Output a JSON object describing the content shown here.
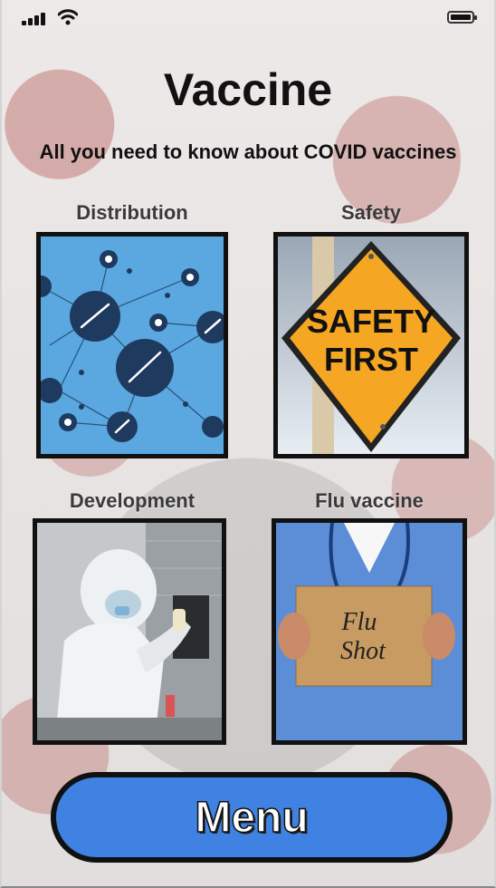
{
  "app": {
    "title": "Vaccine",
    "subtitle": "All you need to know about COVID vaccines"
  },
  "status_bar": {
    "signal_icon": "cellular-signal-icon",
    "wifi_icon": "wifi-icon",
    "battery_icon": "battery-icon"
  },
  "cards": [
    {
      "label": "Distribution",
      "image": "vaccine-network-illustration"
    },
    {
      "label": "Safety",
      "image": "safety-first-sign"
    },
    {
      "label": "Development",
      "image": "lab-scientist-photo"
    },
    {
      "label": "Flu vaccine",
      "image": "flu-shot-sign-photo"
    }
  ],
  "safety_sign": {
    "line1": "SAFETY",
    "line2": "FIRST"
  },
  "flu_sign": {
    "line1": "Flu",
    "line2": "Shot"
  },
  "menu": {
    "label": "Menu"
  },
  "colors": {
    "accent": "#3f82e2",
    "safety_sign": "#f5a623",
    "network_bg": "#5aa8df"
  }
}
